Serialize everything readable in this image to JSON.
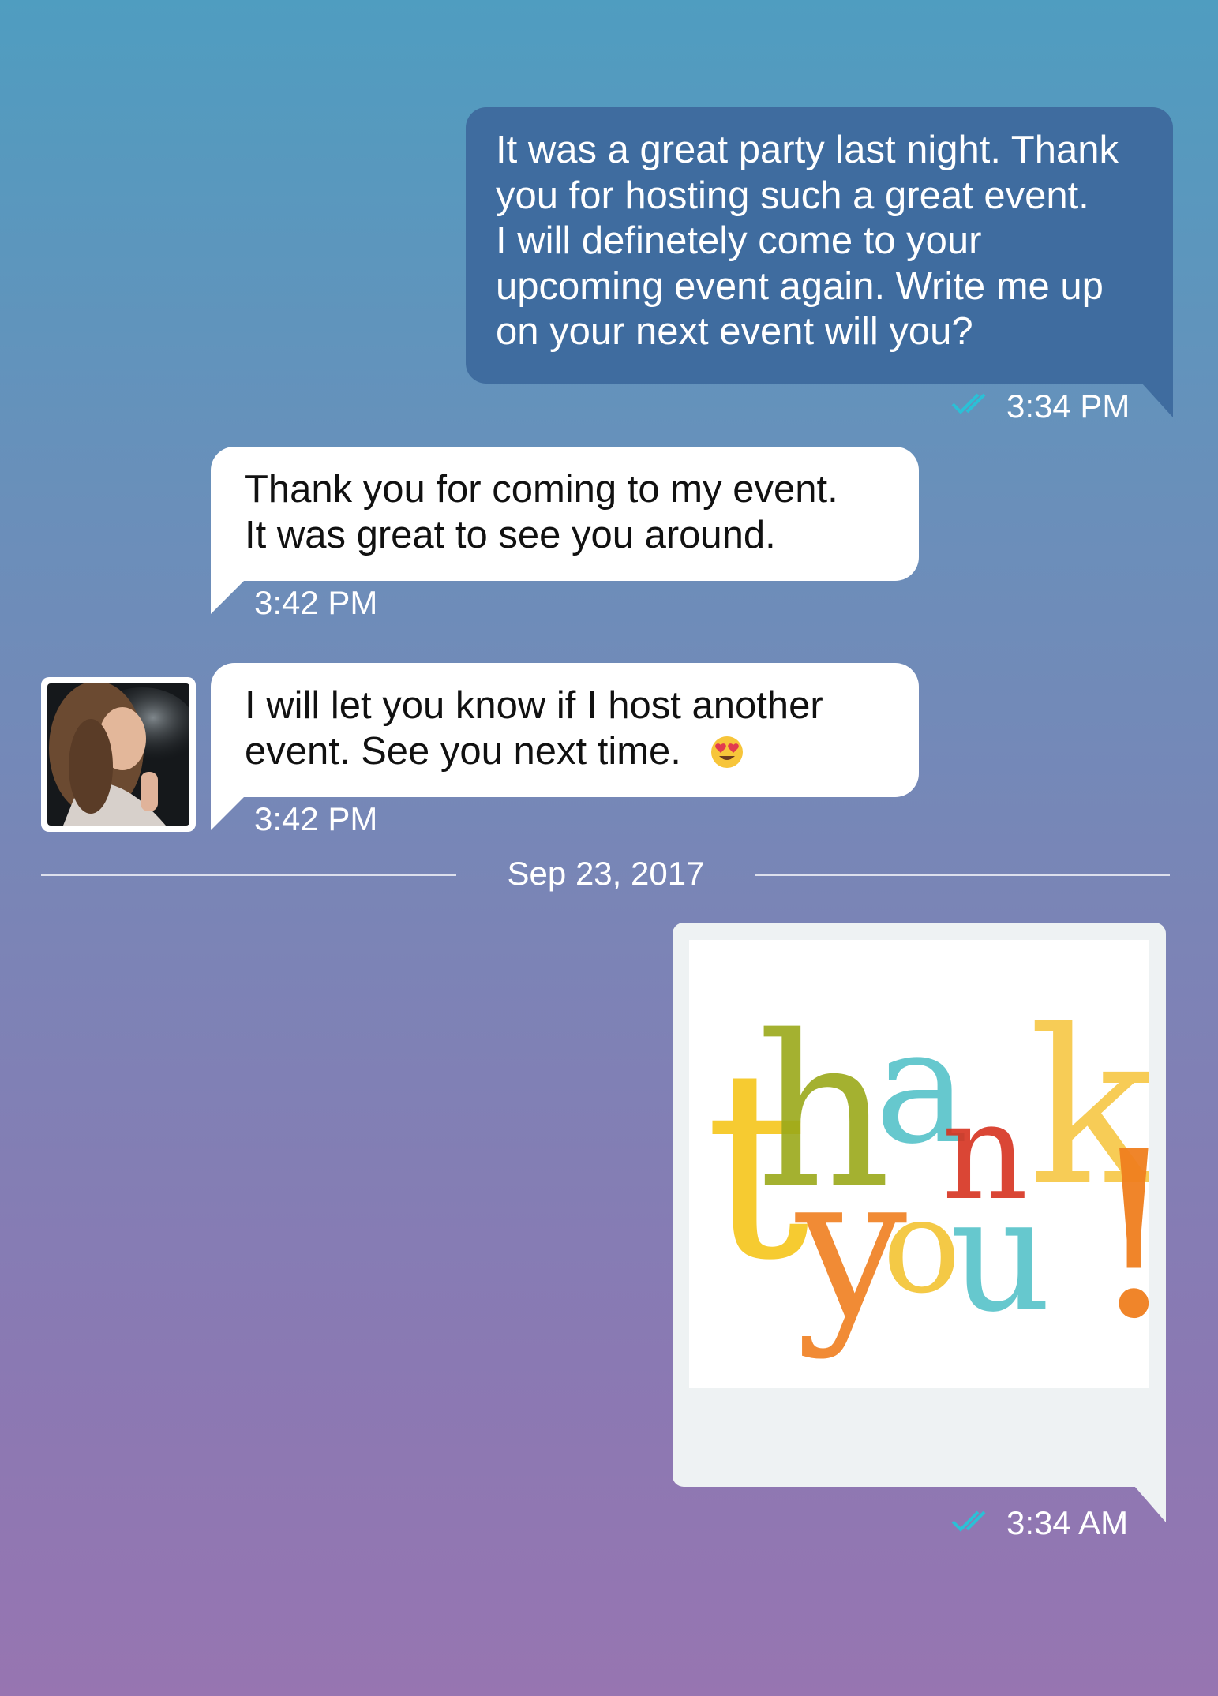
{
  "messages": [
    {
      "direction": "outgoing",
      "text": "It was a great party last night. Thank\nyou for hosting such a great event.\nI will definetely come to your\nupcoming event again. Write me up\non your next event will you?",
      "time": "3:34 PM",
      "status_icon": "double-check-icon"
    },
    {
      "direction": "incoming",
      "text": "Thank you for coming to my event.\nIt was great to see you around.",
      "time": "3:42 PM"
    },
    {
      "direction": "incoming",
      "text": "I will let you know if I host another\nevent. See you next time.",
      "emoji_icon": "heart-eyes-emoji-icon",
      "time": "3:42 PM",
      "avatar_icon": "contact-avatar-photo"
    }
  ],
  "date_divider": "Sep 23, 2017",
  "image_message": {
    "direction": "outgoing",
    "image_icon": "thank-you-card-image",
    "image_text": [
      "than",
      "k",
      "you!"
    ],
    "time": "3:34 AM",
    "status_icon": "double-check-icon"
  },
  "colors": {
    "outgoing_bubble": "#3f6c9f",
    "incoming_bubble": "#ffffff",
    "check_mark": "#2bc0d6",
    "background_top": "#4f9dc0",
    "background_bottom": "#9775b1"
  }
}
